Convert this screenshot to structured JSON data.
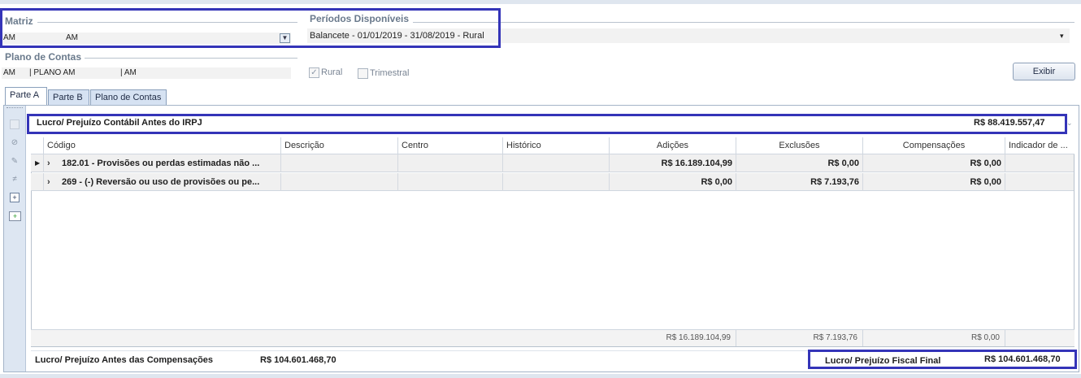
{
  "matriz": {
    "title": "Matriz",
    "code": "AM",
    "name": "AM",
    "dropdown_icon": "chevron-down-icon"
  },
  "periodos": {
    "title": "Períodos Disponíveis",
    "selected": "Balancete - 01/01/2019 - 31/08/2019 - Rural",
    "dropdown_arrow": "▾"
  },
  "plano": {
    "title": "Plano de Contas",
    "code": "AM",
    "name": "| PLANO AM",
    "suffix": "| AM"
  },
  "options": {
    "rural_label": "Rural",
    "rural_checked": true,
    "trimestral_label": "Trimestral",
    "trimestral_checked": false
  },
  "exibir_label": "Exibir",
  "tabs": [
    {
      "label": "Parte A",
      "active": true
    },
    {
      "label": "Parte B",
      "active": false
    },
    {
      "label": "Plano de Contas",
      "active": false
    }
  ],
  "lucro_contabil": {
    "label": "Lucro/ Prejuízo Contábil Antes do IRPJ",
    "value": "R$ 88.419.557,47"
  },
  "grid": {
    "columns": [
      "Código",
      "Descrição",
      "Centro",
      "Histórico",
      "Adições",
      "Exclusões",
      "Compensações",
      "Indicador de ..."
    ],
    "rows": [
      {
        "codigo": "182.01 - Provisões ou perdas estimadas não ...",
        "descricao": "",
        "centro": "",
        "historico": "",
        "adicoes": "R$ 16.189.104,99",
        "exclusoes": "R$ 0,00",
        "compensacoes": "R$ 0,00",
        "indicador": ""
      },
      {
        "codigo": "269 - (-) Reversão ou uso de provisões ou pe...",
        "descricao": "",
        "centro": "",
        "historico": "",
        "adicoes": "R$ 0,00",
        "exclusoes": "R$ 7.193,76",
        "compensacoes": "R$ 0,00",
        "indicador": ""
      }
    ],
    "totals": {
      "adicoes": "R$ 16.189.104,99",
      "exclusoes": "R$ 7.193,76",
      "compensacoes": "R$ 0,00"
    }
  },
  "antes_compensacoes": {
    "label": "Lucro/ Prejuízo Antes das Compensações",
    "value": "R$ 104.601.468,70"
  },
  "fiscal_final": {
    "label": "Lucro/ Prejuízo Fiscal Final",
    "value": "R$ 104.601.468,70"
  }
}
